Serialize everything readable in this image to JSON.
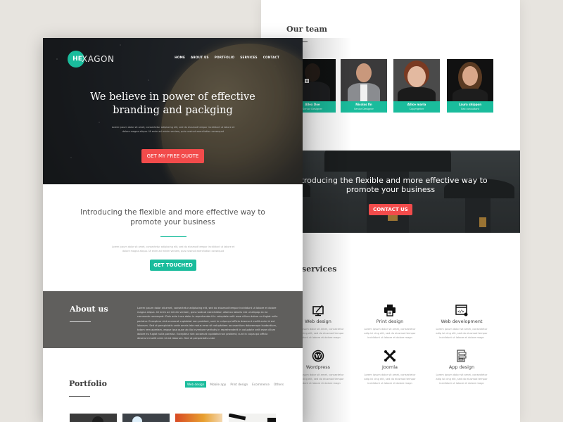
{
  "left_page": {
    "logo": {
      "badge": "HE",
      "rest": "XAGON"
    },
    "nav": [
      "HOME",
      "ABOUT US",
      "PORTFOLIO",
      "SERVICES",
      "CONTACT"
    ],
    "hero": {
      "title_line1": "We believe in power of effective",
      "title_line2": "branding and packging",
      "subtitle": "Lorem ipsum dolor sit amet, consectetur adipiscing elit, sed do eiusmod tempor incididunt ut labore et dolore magna aliqua. Ut enim ad minim veniam, quis nostrud exercitation consequat",
      "button": "GET MY FREE QUOTE"
    },
    "intro": {
      "title_line1": "Introducing the flexible and more effective way to",
      "title_line2": "promote your business",
      "subtitle": "Lorem ipsum dolor sit amet, consectetur adipiscing elit, sed do eiusmod tempor incididunt ut labore et dolore magna aliqua. Ut enim ad minim veniam, quis nostrud exercitation consequat",
      "button": "GET TOUCHED"
    },
    "about": {
      "title": "About us",
      "text": "Lorem ipsum dolor sit amet, consectetur adipiscing elit, sed do eiusmod tempor incididunt ut labore et dolore magna aliqua. Ut enim ad minim veniam, quis nostrud exercitation ullamco laboris nisi ut aliquip ex ea commodo consequat. Duis aute irure dolor in reprehenderit in voluptate velit esse cillum dolore eu fugiat nulla pariatur. Excepteur sint occaecat cupidatat non proident, sunt in culpa qui officia deserunt mollit anim id est laborum. Sed ut perspiciatis unde omnis iste natus error sit voluptatem accusantium doloremque laudantium, totam rem aperiam, eaque ipsa quae ab illo inventore veritatis in reprehenderit in voluptate velit esse cillum dolore eu fugiat nulla pariatur. Excepteur sint occaecat cupidatat non proident, sunt in culpa qui officia deserunt mollit anim id est laborum. Sed ut perspiciatis unde"
    },
    "portfolio": {
      "title": "Portfolio",
      "tabs": [
        "Web design",
        "Mobile app",
        "Print design",
        "Ecommerce",
        "Others"
      ],
      "active_tab": "Web design"
    }
  },
  "right_page": {
    "team": {
      "title": "Our team",
      "members": [
        {
          "name": "Allex Doe",
          "role": "Senior Designer"
        },
        {
          "name": "Nicolas fin",
          "role": "Senior Designer"
        },
        {
          "name": "Allice maria",
          "role": "Copyrighter"
        },
        {
          "name": "Laura shippon",
          "role": "Seo consultant"
        }
      ],
      "social_icons": [
        "facebook-icon",
        "twitter-icon",
        "google-plus-icon"
      ]
    },
    "cta": {
      "title_line1": "Introducing the flexible and more effective way to",
      "title_line2": "promote your business",
      "button": "CONTACT US"
    },
    "services": {
      "title": "services",
      "items": [
        {
          "name": "Web design",
          "icon": "monitor-pen-icon",
          "desc": "Lorem ipsum dolor sit amet, consectetur adip isi cing elit, sed do eiusmod tempor incididunt ut labore et dolore magn"
        },
        {
          "name": "Print design",
          "icon": "printer-icon",
          "desc": "Lorem ipsum dolor sit amet, consectetur adip isi cing elit, sed do eiusmod tempor incididunt ut labore et dolore magn"
        },
        {
          "name": "Web development",
          "icon": "code-window-icon",
          "desc": "Lorem ipsum dolor sit amet, consectetur adip isi cing elit, sed do eiusmod tempor incididunt ut labore et dolore magn"
        },
        {
          "name": "Wordpress",
          "icon": "wordpress-icon",
          "desc": "Lorem ipsum dolor sit amet, consectetur adip isi cing elit, sed do eiusmod tempor incididunt ut labore et dolore magn"
        },
        {
          "name": "Joomla",
          "icon": "joomla-icon",
          "desc": "Lorem ipsum dolor sit amet, consectetur adip isi cing elit, sed do eiusmod tempor incididunt ut labore et dolore magn"
        },
        {
          "name": "App design",
          "icon": "app-layout-icon",
          "desc": "Lorem ipsum dolor sit amet, consectetur adip isi cing elit, sed do eiusmod tempor incididunt ut labore et dolore magn"
        }
      ]
    }
  },
  "colors": {
    "accent": "#1abc9c",
    "cta_red": "#f24b4b",
    "about_bg": "#605f5d",
    "canvas_bg": "#e7e4df"
  }
}
